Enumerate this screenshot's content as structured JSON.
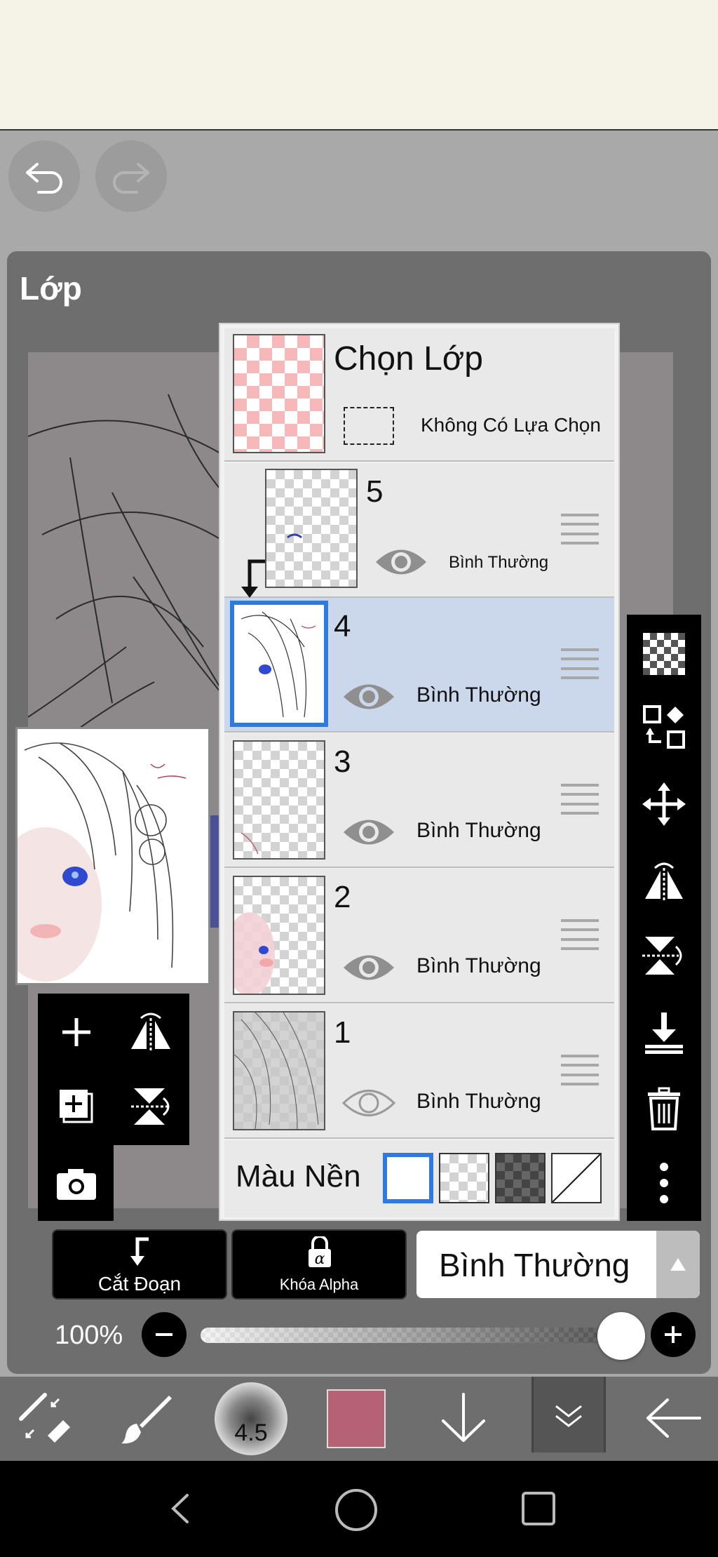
{
  "panel": {
    "title": "Lớp"
  },
  "selection": {
    "title": "Chọn Lớp",
    "status": "Không Có Lựa Chọn"
  },
  "layers": [
    {
      "number": "5",
      "blend": "Bình Thường",
      "visible": true,
      "clipped": true
    },
    {
      "number": "4",
      "blend": "Bình Thường",
      "visible": true,
      "selected": true
    },
    {
      "number": "3",
      "blend": "Bình Thường",
      "visible": true
    },
    {
      "number": "2",
      "blend": "Bình Thường",
      "visible": true
    },
    {
      "number": "1",
      "blend": "Bình Thường",
      "visible": false
    }
  ],
  "background": {
    "label": "Màu Nền",
    "options": [
      "white",
      "transparent",
      "dark-checker",
      "none"
    ],
    "selected": "white"
  },
  "actions": {
    "clip_label": "Cắt Đoạn",
    "alpha_lock_label": "Khóa Alpha",
    "blend_mode": "Bình Thường"
  },
  "opacity": {
    "label": "100%",
    "value": 1.0
  },
  "toolbar": {
    "brush_size": "4.5",
    "color": "#b56274"
  },
  "colors": {
    "accent": "#2f7ae0",
    "selected_row": "#cbd8ec",
    "panel": "#6e6e6e"
  }
}
